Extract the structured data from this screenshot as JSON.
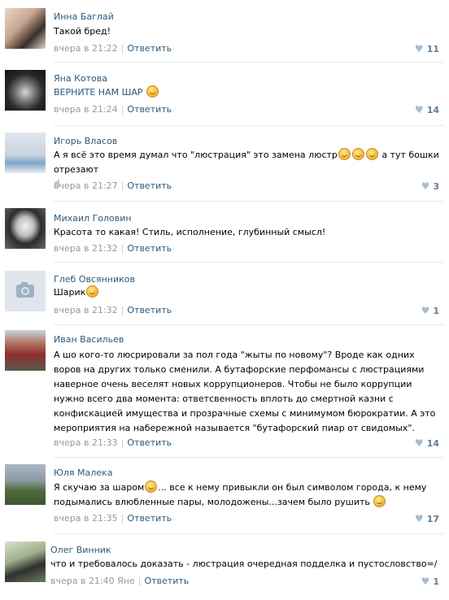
{
  "comments": [
    {
      "author": "Инна Баглай",
      "text": "Такой бред!",
      "time": "вчера в 21:22",
      "reply": "Ответить",
      "likes": "11"
    },
    {
      "author": "Яна Котова",
      "text": "ВЕРНИТЕ НАМ ШАР",
      "time": "вчера в 21:24",
      "reply": "Ответить",
      "likes": "14"
    },
    {
      "author": "Игорь Власов",
      "text": "А я всё это время думал что \"люстрация\" это замена люстр",
      "text_after": "а тут бошки отрезают",
      "time": "вчера в 21:27",
      "reply": "Ответить",
      "likes": "3"
    },
    {
      "author": "Михаил Головин",
      "text": "Красота то какая! Стиль, исполнение, глубинный смысл!",
      "time": "вчера в 21:32",
      "reply": "Ответить",
      "likes": ""
    },
    {
      "author": "Глеб Овсянников",
      "text": "Шарик",
      "time": "вчера в 21:32",
      "reply": "Ответить",
      "likes": "1"
    },
    {
      "author": "Иван Васильев",
      "text": "А шо кого-то люсрировали за пол года \"жыты по новому\"? Вроде как одних воров на других только сменили. А бутафорские перфомансы с люстрациями наверное очень веселят новых коррупционеров. Чтобы не было коррупции нужно всего два момента: ответсвенность вплоть до смертной казни с конфискацией имущества и прозрачные схемы с минимумом бюрократии. А это мероприятия на набережной называется \"бутафорский пиар от свидомых\".",
      "time": "вчера в 21:33",
      "reply": "Ответить",
      "likes": "14"
    },
    {
      "author": "Юля Малека",
      "text": "Я скучаю за шаром",
      "text_after": "... все к нему привыкли он был символом города, к нему подымались влюбленные пары, молодожены...зачем было рушить",
      "time": "вчера в 21:35",
      "reply": "Ответить",
      "likes": "17"
    },
    {
      "author": "Олег Винник",
      "text": "что и требовалось доказать - люстрация очередная подделка и пустословство=/",
      "time": "вчера в 21:40",
      "to": "Яне",
      "reply": "Ответить",
      "likes": "1"
    }
  ],
  "colors": {
    "link": "#2b587a",
    "meta": "#999999",
    "like_icon": "#a8bcd0"
  },
  "icons": {
    "like": "heart-icon",
    "smile": "smile-icon",
    "camera": "camera-icon",
    "hand": "hand-icon"
  }
}
